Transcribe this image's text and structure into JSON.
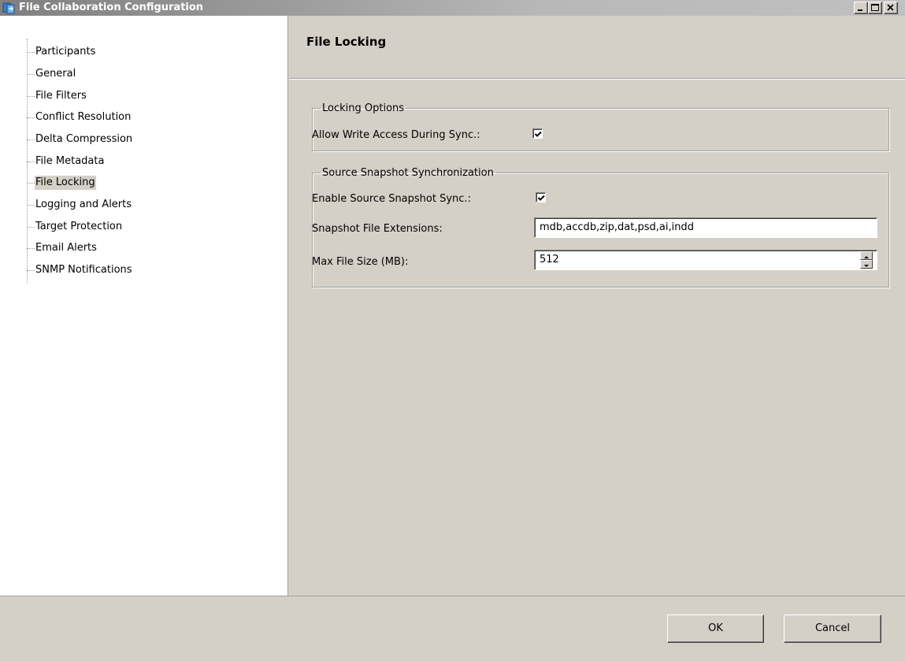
{
  "window": {
    "title": "File Collaboration Configuration",
    "icon": "app-icon",
    "controls": [
      "minimize-icon",
      "maximize-icon",
      "close-icon"
    ]
  },
  "tree": {
    "items": [
      {
        "label": "Participants"
      },
      {
        "label": "General"
      },
      {
        "label": "File Filters"
      },
      {
        "label": "Conflict Resolution"
      },
      {
        "label": "Delta Compression"
      },
      {
        "label": "File Metadata"
      },
      {
        "label": "File Locking",
        "selected": true
      },
      {
        "label": "Logging and Alerts"
      },
      {
        "label": "Target Protection"
      },
      {
        "label": "Email Alerts"
      },
      {
        "label": "SNMP Notifications"
      }
    ]
  },
  "main": {
    "title": "File Locking",
    "locking_options": {
      "legend": "Locking Options",
      "allow_write_label": "Allow Write Access During Sync.:",
      "allow_write_checked": true
    },
    "snapshot": {
      "legend": "Source Snapshot Synchronization",
      "enable_label": "Enable Source Snapshot Sync.:",
      "enable_checked": true,
      "extensions_label": "Snapshot File Extensions:",
      "extensions_value": "mdb,accdb,zip,dat,psd,ai,indd",
      "max_size_label": "Max File Size (MB):",
      "max_size_value": "512"
    }
  },
  "buttons": {
    "ok": "OK",
    "cancel": "Cancel"
  },
  "colors": {
    "window_bg": "#d4d0c8",
    "tree_bg": "#ffffff",
    "title_text": "#ffffff"
  }
}
